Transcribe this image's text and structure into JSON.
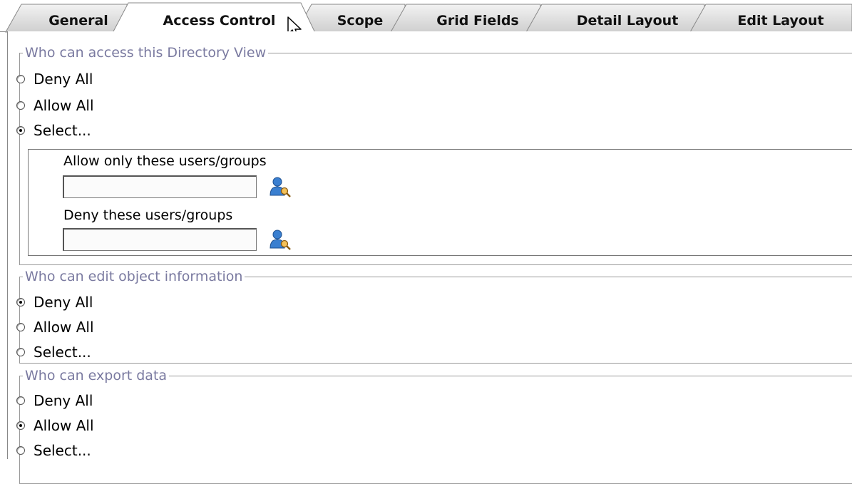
{
  "tabs": [
    {
      "label": "General",
      "active": false
    },
    {
      "label": "Access Control",
      "active": true
    },
    {
      "label": "Scope",
      "active": false
    },
    {
      "label": "Grid Fields",
      "active": false
    },
    {
      "label": "Detail Layout",
      "active": false
    },
    {
      "label": "Edit Layout",
      "active": false
    }
  ],
  "access": {
    "legend": "Who can access this Directory View",
    "options": [
      "Deny All",
      "Allow All",
      "Select..."
    ],
    "selected": "Select...",
    "allow_label": "Allow only these users/groups",
    "allow_value": "",
    "deny_label": "Deny these users/groups",
    "deny_value": ""
  },
  "edit": {
    "legend": "Who can edit object information",
    "options": [
      "Deny All",
      "Allow All",
      "Select..."
    ],
    "selected": "Deny All"
  },
  "export": {
    "legend": "Who can export data",
    "options": [
      "Deny All",
      "Allow All",
      "Select..."
    ],
    "selected": "Allow All"
  },
  "icons": {
    "user_picker": "user-search-icon",
    "cursor": "mouse-pointer-icon"
  },
  "colors": {
    "legend_text": "#7a7aa0",
    "inactive_tab": "#d4d4d4",
    "active_tab": "#ffffff"
  }
}
